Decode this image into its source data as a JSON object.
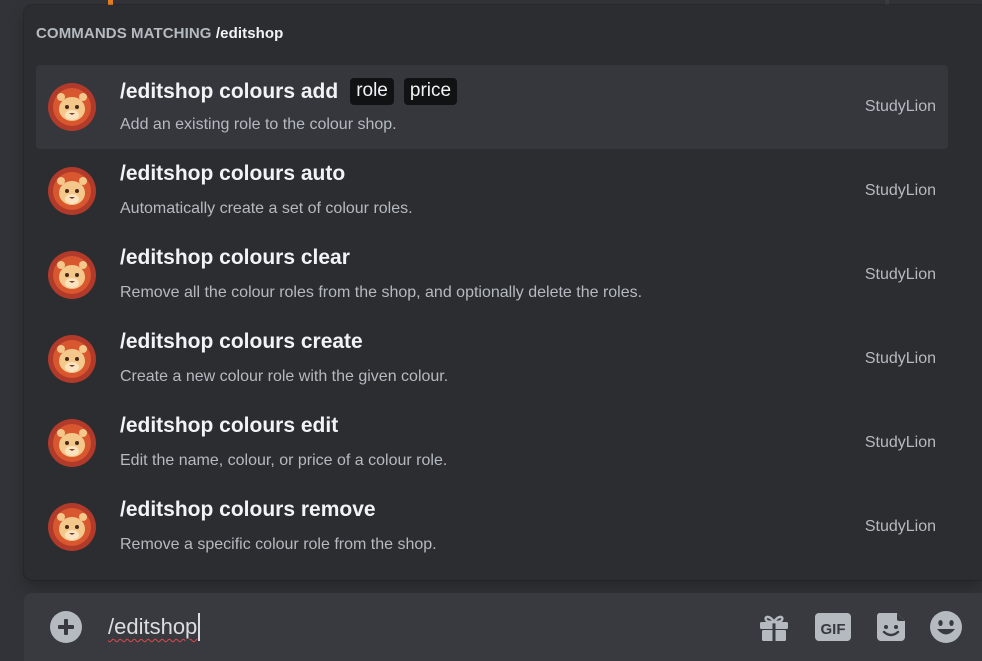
{
  "popup": {
    "header_prefix": "COMMANDS MATCHING",
    "header_query": "/editshop"
  },
  "commands": [
    {
      "name": "/editshop colours add",
      "options": [
        "role",
        "price"
      ],
      "description": "Add an existing role to the colour shop.",
      "source": "StudyLion",
      "selected": true
    },
    {
      "name": "/editshop colours auto",
      "options": [],
      "description": "Automatically create a set of colour roles.",
      "source": "StudyLion",
      "selected": false
    },
    {
      "name": "/editshop colours clear",
      "options": [],
      "description": "Remove all the colour roles from the shop, and optionally delete the roles.",
      "source": "StudyLion",
      "selected": false
    },
    {
      "name": "/editshop colours create",
      "options": [],
      "description": "Create a new colour role with the given colour.",
      "source": "StudyLion",
      "selected": false
    },
    {
      "name": "/editshop colours edit",
      "options": [],
      "description": "Edit the name, colour, or price of a colour role.",
      "source": "StudyLion",
      "selected": false
    },
    {
      "name": "/editshop colours remove",
      "options": [],
      "description": "Remove a specific colour role from the shop.",
      "source": "StudyLion",
      "selected": false
    }
  ],
  "composer": {
    "value": "/editshop",
    "gif_label": "GIF"
  },
  "icons": {
    "add": "plus-circle-icon",
    "gift": "gift-icon",
    "gif": "gif-icon",
    "sticker": "sticker-icon",
    "emoji": "emoji-icon",
    "avatar": "lion-avatar-icon"
  },
  "colors": {
    "popup_bg": "#2b2d31",
    "selected_row": "#35373c",
    "composer_bg": "#383a40",
    "option_pill": "#111214",
    "accent_orange": "#e67e22"
  }
}
